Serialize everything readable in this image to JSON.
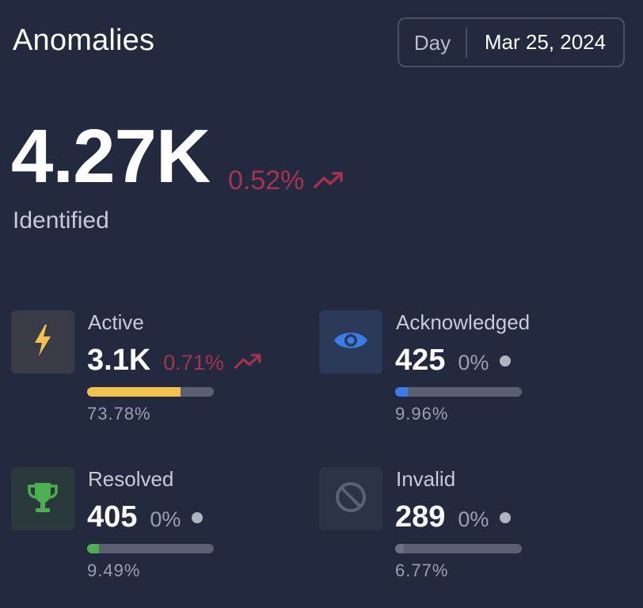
{
  "header": {
    "title": "Anomalies",
    "period": "Day",
    "date": "Mar 25, 2024"
  },
  "summary": {
    "value": "4.27K",
    "change": "0.52%",
    "label": "Identified",
    "trend_icon": "trending-up-icon"
  },
  "colors": {
    "background": "#232a40",
    "up": "#a6324f",
    "active": "#f2c14e",
    "acknowledged": "#3a7de8",
    "resolved": "#4caf50",
    "invalid": "#5a6178"
  },
  "cards": [
    {
      "id": "active",
      "name": "Active",
      "value": "3.1K",
      "change": "0.71%",
      "trend": "up",
      "icon": "lightning-icon",
      "percent_label": "73.78%",
      "fraction": 0.7378
    },
    {
      "id": "acknowledged",
      "name": "Acknowledged",
      "value": "425",
      "change": "0%",
      "trend": "flat",
      "icon": "eye-icon",
      "percent_label": "9.96%",
      "fraction": 0.0996
    },
    {
      "id": "resolved",
      "name": "Resolved",
      "value": "405",
      "change": "0%",
      "trend": "flat",
      "icon": "trophy-icon",
      "percent_label": "9.49%",
      "fraction": 0.0949
    },
    {
      "id": "invalid",
      "name": "Invalid",
      "value": "289",
      "change": "0%",
      "trend": "flat",
      "icon": "ban-icon",
      "percent_label": "6.77%",
      "fraction": 0.0677
    }
  ]
}
